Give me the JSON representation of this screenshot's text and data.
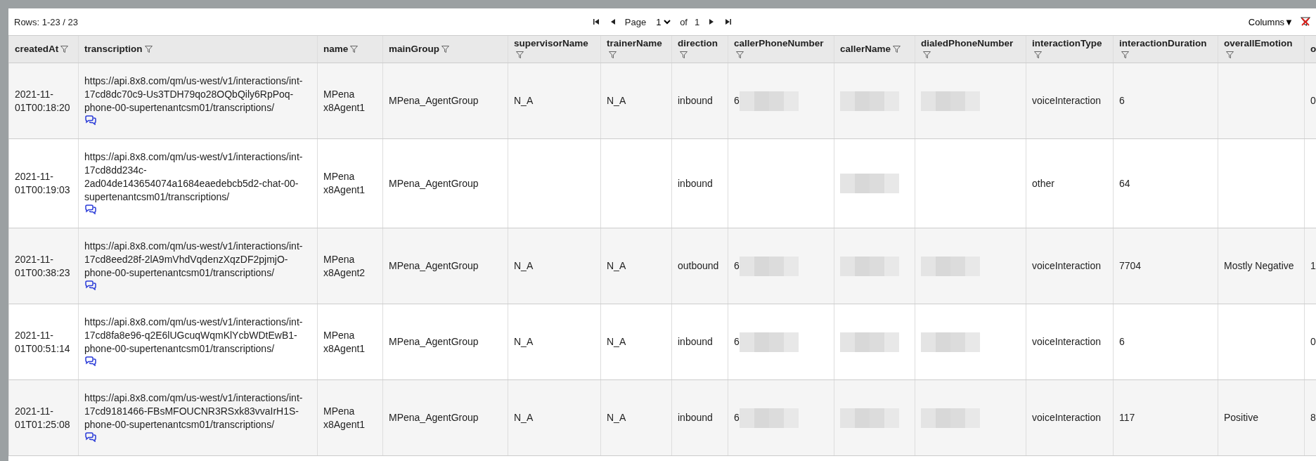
{
  "toolbar": {
    "rows_label": "Rows: 1-23 / 23",
    "page_label": "Page",
    "page_value": "1",
    "of_label": "of",
    "page_count": "1",
    "columns_button": "Columns▼"
  },
  "table": {
    "columns": [
      {
        "label": "createdAt"
      },
      {
        "label": "transcription"
      },
      {
        "label": "name"
      },
      {
        "label": "mainGroup"
      },
      {
        "label": "supervisorName"
      },
      {
        "label": "trainerName"
      },
      {
        "label": "direction"
      },
      {
        "label": "callerPhoneNumber"
      },
      {
        "label": "callerName"
      },
      {
        "label": "dialedPhoneNumber"
      },
      {
        "label": "interactionType"
      },
      {
        "label": "interactionDuration"
      },
      {
        "label": "overallEmotion"
      },
      {
        "label": "o"
      }
    ],
    "rows": [
      {
        "cells": [
          {
            "text": "2021-11-01T00:18:20"
          },
          {
            "text": "https://api.8x8.com/qm/us-west/v1/interactions/int-17cd8dc70c9-Us3TDH79qo28OQbQily6RpPoq-phone-00-supertenantcsm01/transcriptions/",
            "transcript_link": true
          },
          {
            "text": "MPena x8Agent1"
          },
          {
            "text": "MPena_AgentGroup"
          },
          {
            "text": "N_A"
          },
          {
            "text": "N_A"
          },
          {
            "text": "inbound"
          },
          {
            "text": "6",
            "redacted": true
          },
          {
            "redacted": true
          },
          {
            "redacted": true
          },
          {
            "text": "voiceInteraction"
          },
          {
            "text": "6"
          },
          {},
          {
            "text": "0"
          }
        ]
      },
      {
        "cells": [
          {
            "text": "2021-11-01T00:19:03"
          },
          {
            "text": "https://api.8x8.com/qm/us-west/v1/interactions/int-17cd8dd234c-2ad04de143654074a1684eaedebcb5d2-chat-00-supertenantcsm01/transcriptions/",
            "transcript_link": true
          },
          {
            "text": "MPena x8Agent1"
          },
          {
            "text": "MPena_AgentGroup"
          },
          {},
          {},
          {
            "text": "inbound"
          },
          {},
          {
            "redacted": true
          },
          {},
          {
            "text": "other"
          },
          {
            "text": "64"
          },
          {},
          {}
        ]
      },
      {
        "cells": [
          {
            "text": "2021-11-01T00:38:23"
          },
          {
            "text": "https://api.8x8.com/qm/us-west/v1/interactions/int-17cd8eed28f-2lA9mVhdVqdenzXqzDF2pjmjO-phone-00-supertenantcsm01/transcriptions/",
            "transcript_link": true
          },
          {
            "text": "MPena x8Agent2"
          },
          {
            "text": "MPena_AgentGroup"
          },
          {
            "text": "N_A"
          },
          {
            "text": "N_A"
          },
          {
            "text": "outbound"
          },
          {
            "text": "6",
            "redacted": true
          },
          {
            "redacted": true
          },
          {
            "redacted": true
          },
          {
            "text": "voiceInteraction"
          },
          {
            "text": "7704"
          },
          {
            "text": "Mostly Negative"
          },
          {
            "text": "1"
          }
        ]
      },
      {
        "cells": [
          {
            "text": "2021-11-01T00:51:14"
          },
          {
            "text": "https://api.8x8.com/qm/us-west/v1/interactions/int-17cd8fa8e96-q2E6lUGcuqWqmKlYcbWDtEwB1-phone-00-supertenantcsm01/transcriptions/",
            "transcript_link": true
          },
          {
            "text": "MPena x8Agent1"
          },
          {
            "text": "MPena_AgentGroup"
          },
          {
            "text": "N_A"
          },
          {
            "text": "N_A"
          },
          {
            "text": "inbound"
          },
          {
            "text": "6",
            "redacted": true
          },
          {
            "redacted": true
          },
          {
            "redacted": true
          },
          {
            "text": "voiceInteraction"
          },
          {
            "text": "6"
          },
          {},
          {
            "text": "0"
          }
        ]
      },
      {
        "cells": [
          {
            "text": "2021-11-01T01:25:08"
          },
          {
            "text": "https://api.8x8.com/qm/us-west/v1/interactions/int-17cd9181466-FBsMFOUCNR3RSxk83vvaIrH1S-phone-00-supertenantcsm01/transcriptions/",
            "transcript_link": true
          },
          {
            "text": "MPena x8Agent1"
          },
          {
            "text": "MPena_AgentGroup"
          },
          {
            "text": "N_A"
          },
          {
            "text": "N_A"
          },
          {
            "text": "inbound"
          },
          {
            "text": "6",
            "redacted": true
          },
          {
            "redacted": true
          },
          {
            "redacted": true
          },
          {
            "text": "voiceInteraction"
          },
          {
            "text": "117"
          },
          {
            "text": "Positive"
          },
          {
            "text": "8"
          }
        ]
      }
    ]
  }
}
